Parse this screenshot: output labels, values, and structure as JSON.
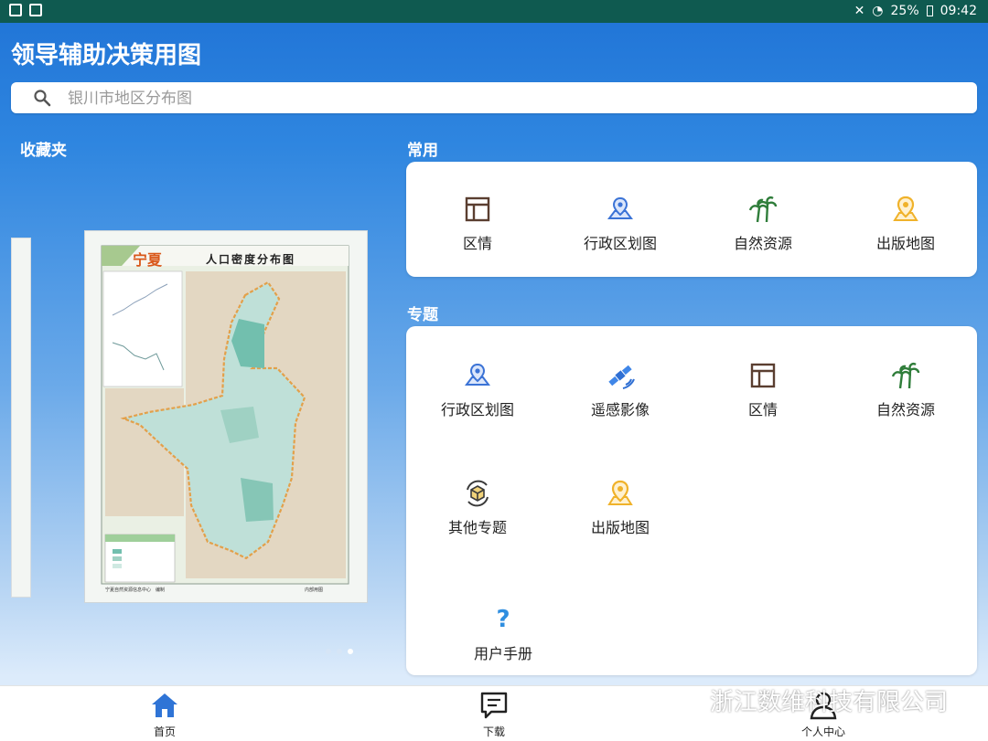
{
  "status": {
    "battery": "25%",
    "time": "09:42"
  },
  "app_title": "领导辅助决策用图",
  "search": {
    "placeholder": "银川市地区分布图"
  },
  "favorites": {
    "label": "收藏夹",
    "map": {
      "title": "人口密度分布图",
      "brand": "宁夏",
      "footer_left": "宁夏自然资源信息中心　编制",
      "footer_right": "内部用图"
    },
    "carousel": {
      "count": 3,
      "active_index": 2
    }
  },
  "common": {
    "label": "常用",
    "items": [
      {
        "label": "区情",
        "icon": "layout-icon"
      },
      {
        "label": "行政区划图",
        "icon": "map-pin-icon"
      },
      {
        "label": "自然资源",
        "icon": "palm-trees-icon"
      },
      {
        "label": "出版地图",
        "icon": "location-pin-icon"
      }
    ]
  },
  "topics": {
    "label": "专题",
    "items": [
      {
        "label": "行政区划图",
        "icon": "map-pin-icon"
      },
      {
        "label": "遥感影像",
        "icon": "satellite-icon"
      },
      {
        "label": "区情",
        "icon": "layout-icon"
      },
      {
        "label": "自然资源",
        "icon": "palm-trees-icon"
      },
      {
        "label": "其他专题",
        "icon": "cube-icon"
      },
      {
        "label": "出版地图",
        "icon": "location-pin-icon"
      },
      {
        "label": "用户手册",
        "icon": "question-icon"
      }
    ]
  },
  "bottom_nav": [
    {
      "label": "首页",
      "icon": "home-icon",
      "active": true
    },
    {
      "label": "下载",
      "icon": "download-message-icon",
      "active": false
    },
    {
      "label": "个人中心",
      "icon": "person-icon",
      "active": false
    }
  ],
  "watermark": "浙江数维科技有限公司",
  "colors": {
    "header_blue": "#1f73d6",
    "statusbar_green": "#0f5a50",
    "icon_blue": "#3b73d6",
    "icon_green": "#2f7d3a",
    "icon_yellow": "#f0b22a",
    "icon_dark": "#5a3e30"
  }
}
